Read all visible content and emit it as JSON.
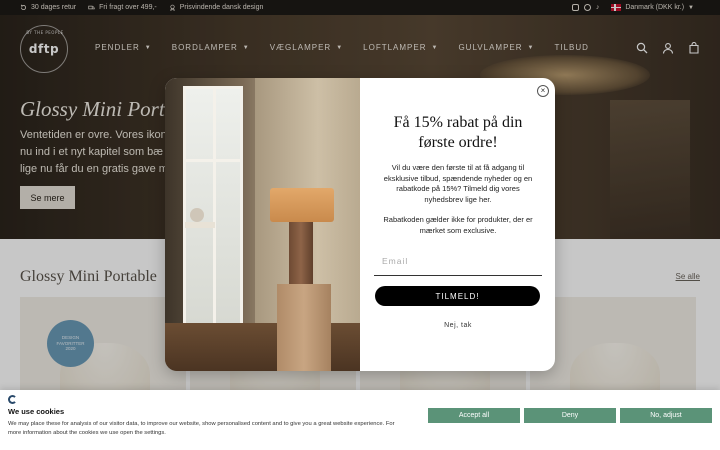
{
  "announcement": {
    "perks": [
      "30 dages retur",
      "Fri fragt over 499,-",
      "Prisvindende dansk design"
    ],
    "social": [
      "instagram-icon",
      "facebook-icon",
      "tiktok-icon"
    ],
    "region": "Danmark (DKK kr.)"
  },
  "header": {
    "logo_text": "dftp",
    "logo_arc": "BY THE PEOPLE",
    "nav": [
      {
        "label": "PENDLER",
        "has_caret": true
      },
      {
        "label": "BORDLAMPER",
        "has_caret": true
      },
      {
        "label": "VÆGLAMPER",
        "has_caret": true
      },
      {
        "label": "LOFTLAMPER",
        "has_caret": true
      },
      {
        "label": "GULVLAMPER",
        "has_caret": true
      },
      {
        "label": "TILBUD",
        "has_caret": false
      }
    ],
    "icons": [
      "search-icon",
      "account-icon",
      "cart-icon"
    ]
  },
  "hero": {
    "title": "Glossy Mini Port",
    "text_lines": [
      "Ventetiden er ovre. Vores ikon",
      "nu ind i et nyt kapitel som bæ",
      "lige nu får du en gratis gave m"
    ],
    "button": "Se mere"
  },
  "section": {
    "title": "Glossy Mini Portable",
    "see_all": "Se alle",
    "badge_lines": [
      "DESIGN",
      "FAVORITTER",
      "2020"
    ]
  },
  "popup": {
    "headline_lines": [
      "Få 15% rabat på din",
      "første ordre!"
    ],
    "lead_lines": [
      "Vil du være den første til at få adgang til",
      "eksklusive tilbud, spændende nyheder og en",
      "rabatkode på 15%? Tilmeld dig vores",
      "nyhedsbrev lige her."
    ],
    "note_lines": [
      "Rabatkoden gælder ikke for produkter, der er",
      "mærket som exclusive."
    ],
    "email_placeholder": "Email",
    "submit": "TILMELD!",
    "decline": "Nej, tak",
    "close": "×"
  },
  "cookie": {
    "title": "We use cookies",
    "text_lines": [
      "We may place these for analysis of our visitor data, to improve our website, show personalised content and to give you a great website experience. For",
      "more information about the cookies we use open the settings."
    ],
    "buttons": [
      "Accept all",
      "Deny",
      "No, adjust"
    ],
    "button_color": "#5b9378"
  },
  "colors": {
    "topbar_bg": "#1d1a17",
    "cta_bg": "#000000",
    "badge_bg": "#6a9ab7"
  }
}
